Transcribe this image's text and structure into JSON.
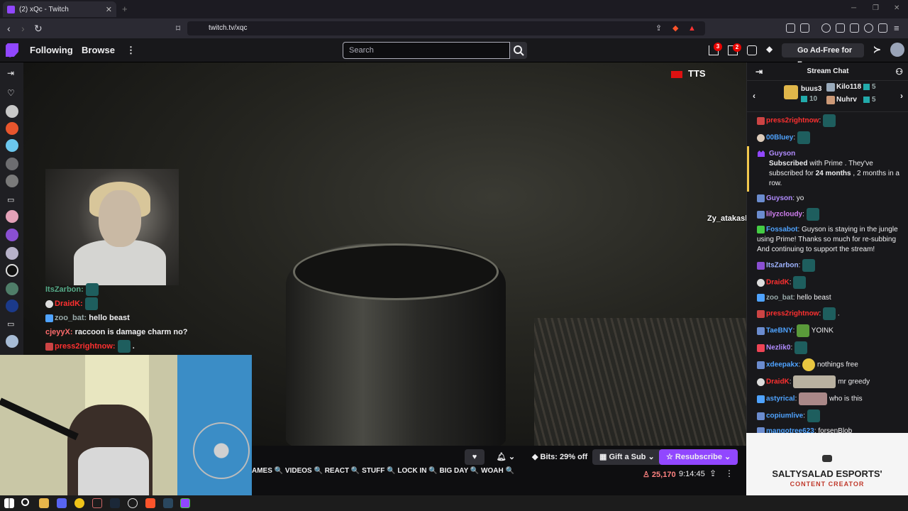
{
  "browser": {
    "tab_title": "(2) xQc - Twitch",
    "url": "twitch.tv/xqc"
  },
  "topnav": {
    "following": "Following",
    "browse": "Browse",
    "search_placeholder": "Search",
    "inbox_count": "3",
    "notif_count": "2",
    "ad_free": "Go Ad-Free for Free"
  },
  "video": {
    "tts": "TTS",
    "floating_name": "Zy_atakashi aga nyan",
    "overlay_chat": [
      {
        "user": "ItsZarbon:",
        "text": "",
        "color": "#8aa"
      },
      {
        "user": "DraidK:",
        "text": "",
        "color": "#ff3030"
      },
      {
        "user": "zoo_bat:",
        "text": "hello beast",
        "color": "#9aa"
      },
      {
        "user": "cjeyyX:",
        "text": "raccoon is damage charm no?",
        "color": "#ff6b6b"
      },
      {
        "user": "press2rightnow:",
        "text": ".",
        "color": "#ff3030"
      }
    ]
  },
  "actions": {
    "bits": "Bits: 29% off",
    "gift": "Gift a Sub",
    "resub": "Resubscribe",
    "tags_line": "AMES 🔍 VIDEOS 🔍 REACT 🔍 STUFF 🔍 LOCK IN 🔍 BIG DAY 🔍 WOAH 🔍",
    "viewers": "25,170",
    "uptime": "9:14:45"
  },
  "chat": {
    "header": "Stream Chat",
    "gifters": [
      {
        "name": "buus3",
        "count": "10"
      },
      {
        "name": "Kilo118",
        "count": "5"
      },
      {
        "name": "Nuhrv",
        "count": "5"
      }
    ],
    "sub_notice": {
      "user": "Guyson",
      "line1": "Subscribed",
      "line2": "with Prime . They've subscribed for",
      "months": "24 months",
      "line3": ", 2 months in a row."
    },
    "messages": [
      {
        "user": "press2rightnow",
        "text": "",
        "color": "#ff3030"
      },
      {
        "user": "00Bluey",
        "text": "",
        "color": "#4fa3ff"
      },
      {
        "user": "Guyson",
        "text": "yo",
        "color": "#b18cff"
      },
      {
        "user": "lilyzcloudy",
        "text": "",
        "color": "#d07ff0"
      },
      {
        "user": "Fossabot",
        "text": "Guyson is staying in the jungle using Prime! Thanks so much for re-subbing And continuing to support the stream!",
        "color": "#4fa3ff"
      },
      {
        "user": "ItsZarbon",
        "text": "",
        "color": "#9fb4ff"
      },
      {
        "user": "DraidK",
        "text": "",
        "color": "#ff3030"
      },
      {
        "user": "zoo_bat",
        "text": "hello beast",
        "color": "#9aa"
      },
      {
        "user": "press2rightnow",
        "text": ".",
        "color": "#ff3030"
      },
      {
        "user": "TaeBNY",
        "text": "YOINK",
        "color": "#4fa3ff"
      },
      {
        "user": "Nezlik0",
        "text": "",
        "color": "#b18cff"
      },
      {
        "user": "xdeepakx",
        "text": "nothings free",
        "color": "#4fa3ff"
      },
      {
        "user": "DraidK",
        "text": "mr greedy",
        "color": "#ff3030"
      },
      {
        "user": "astyrical",
        "text": "who is this",
        "color": "#4fa3ff"
      },
      {
        "user": "copiumlive",
        "text": "",
        "color": "#4fa3ff"
      },
      {
        "user": "mangotree623",
        "text": "forsenBlob",
        "color": "#4fa3ff"
      }
    ]
  },
  "promo": {
    "title": "SALTYSALAD ESPORTS'",
    "subtitle": "CONTENT CREATOR"
  }
}
